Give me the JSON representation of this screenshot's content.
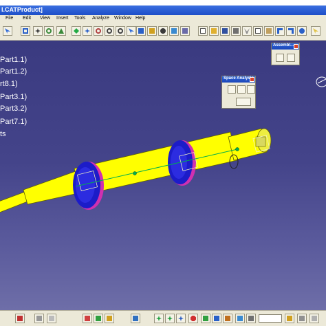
{
  "window": {
    "title": "l.CATProduct]"
  },
  "menu": [
    "File",
    "Edit",
    "View",
    "Insert",
    "Tools",
    "Analyze",
    "Window",
    "Help"
  ],
  "tree": [
    "Part1.1)",
    "Part1.2)",
    "rt8.1)",
    "Part3.1)",
    "Part3.2)",
    "Part7.1)",
    "ts"
  ],
  "toolbars": {
    "assembly": {
      "title": "Assembl..."
    },
    "space_analysis": {
      "title": "Space Analysis"
    }
  },
  "status": {
    "zoom_value": ""
  },
  "colors": {
    "viewport": "#44448a",
    "shaft": "#ffff00",
    "bearing": "#1c1cc8",
    "bearing_ring": "#e040c0",
    "axis_line": "#00b050",
    "chrome": "#ece9d8",
    "titlebar": "#1d4ec8"
  },
  "icons": [
    "arrow-icon",
    "fit-all-icon",
    "pan-icon",
    "rotate-icon",
    "zoom-in-icon",
    "zoom-out-icon",
    "normal-view-icon",
    "iso-view-icon",
    "shading-icon",
    "hide-show-icon",
    "new-icon",
    "open-icon",
    "save-icon",
    "print-icon",
    "cut-icon",
    "copy-icon",
    "paste-icon",
    "undo-icon",
    "redo-icon",
    "help-icon",
    "compass-icon"
  ]
}
